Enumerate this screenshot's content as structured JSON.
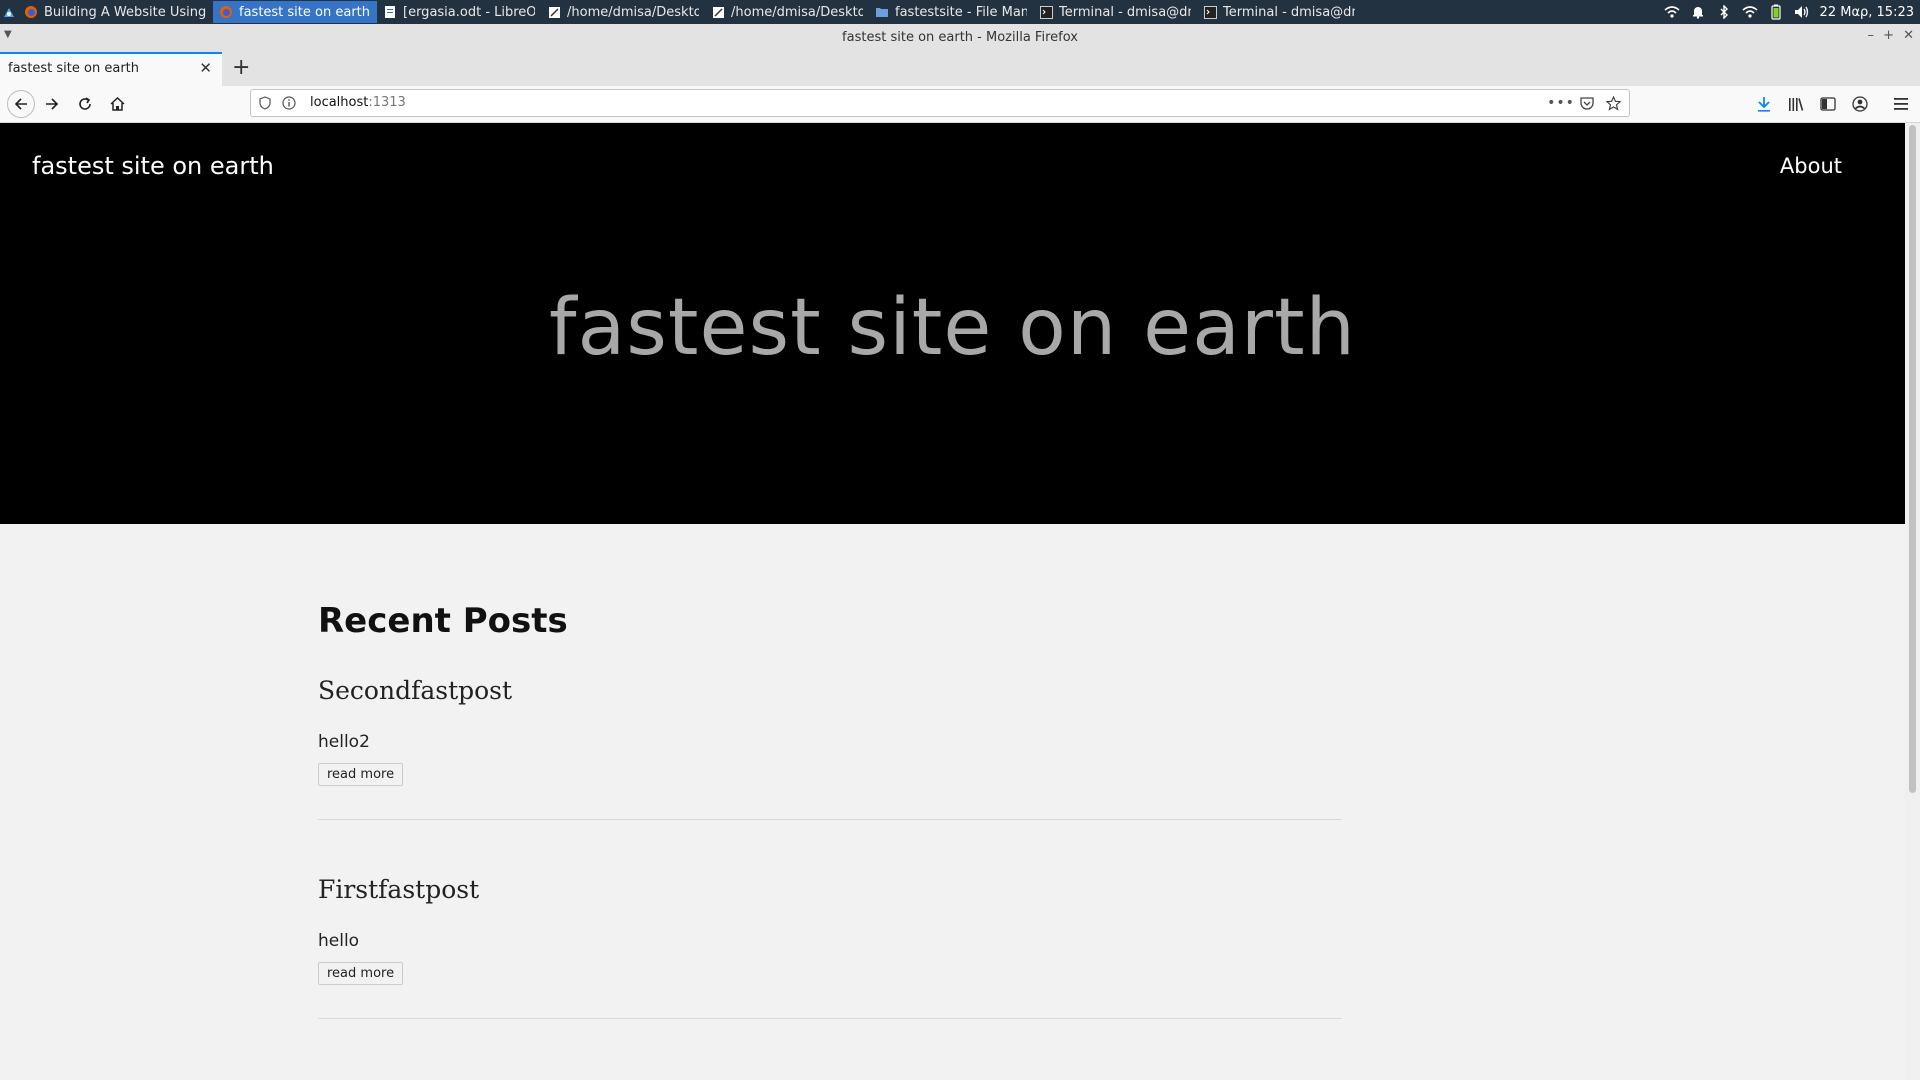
{
  "taskbar": {
    "tasks": [
      {
        "label": "Building A Website Using Hu...",
        "icon": "firefox-icon"
      },
      {
        "label": "fastest site on earth - Mozilla...",
        "icon": "firefox-icon",
        "active": true
      },
      {
        "label": "[ergasia.odt - LibreOffice Wri...",
        "icon": "writer-icon"
      },
      {
        "label": "/home/dmisa/Desktop/faste...",
        "icon": "editor-icon"
      },
      {
        "label": "/home/dmisa/Desktop/faste...",
        "icon": "editor-icon"
      },
      {
        "label": "fastestsite - File Manager",
        "icon": "folder-icon"
      },
      {
        "label": "Terminal - dmisa@dmisa-Le...",
        "icon": "terminal-icon"
      },
      {
        "label": "Terminal - dmisa@dmisa-Le...",
        "icon": "terminal-icon"
      }
    ],
    "clock": "22 Μαρ, 15:23"
  },
  "window": {
    "title": "fastest site on earth - Mozilla Firefox"
  },
  "browser": {
    "tab_label": "fastest site on earth",
    "url_host": "localhost",
    "url_port": ":1313"
  },
  "site": {
    "name": "fastest site on earth",
    "nav_about": "About",
    "hero_title": "fastest site on earth",
    "section_title": "Recent Posts",
    "posts": [
      {
        "title": "Secondfastpost",
        "summary": "hello2",
        "read_more": "read more"
      },
      {
        "title": "Firstfastpost",
        "summary": "hello",
        "read_more": "read more"
      }
    ]
  },
  "colors": {
    "hero_bg": "#000000",
    "hero_title": "#a8a8a8",
    "accent": "#0a84ff",
    "taskbar_bg": "#233241",
    "active_task": "#3574c6"
  }
}
